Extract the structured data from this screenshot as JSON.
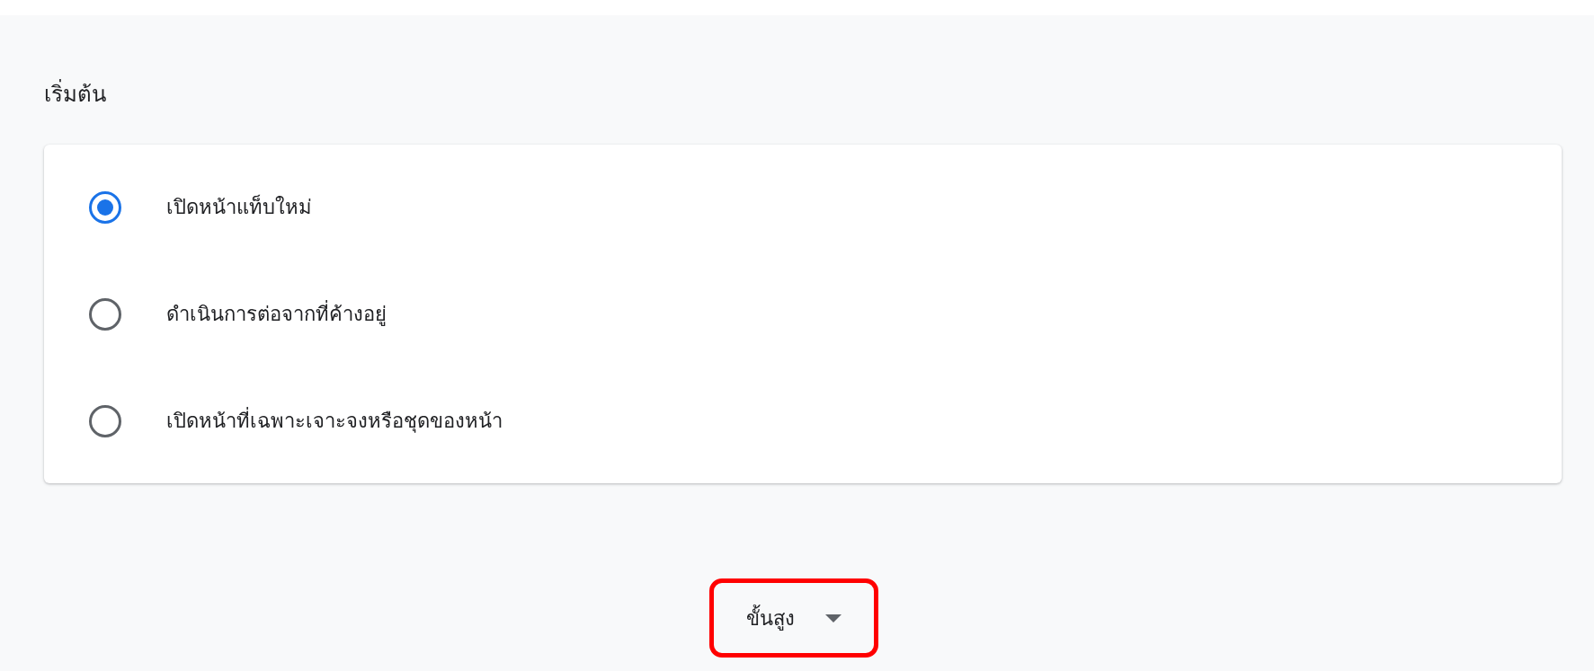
{
  "section": {
    "title": "เริ่มต้น"
  },
  "options": [
    {
      "label": "เปิดหน้าแท็บใหม่",
      "selected": true
    },
    {
      "label": "ดำเนินการต่อจากที่ค้างอยู่",
      "selected": false
    },
    {
      "label": "เปิดหน้าที่เฉพาะเจาะจงหรือชุดของหน้า",
      "selected": false
    }
  ],
  "advanced_button": {
    "label": "ขั้นสูง",
    "highlighted": true
  }
}
